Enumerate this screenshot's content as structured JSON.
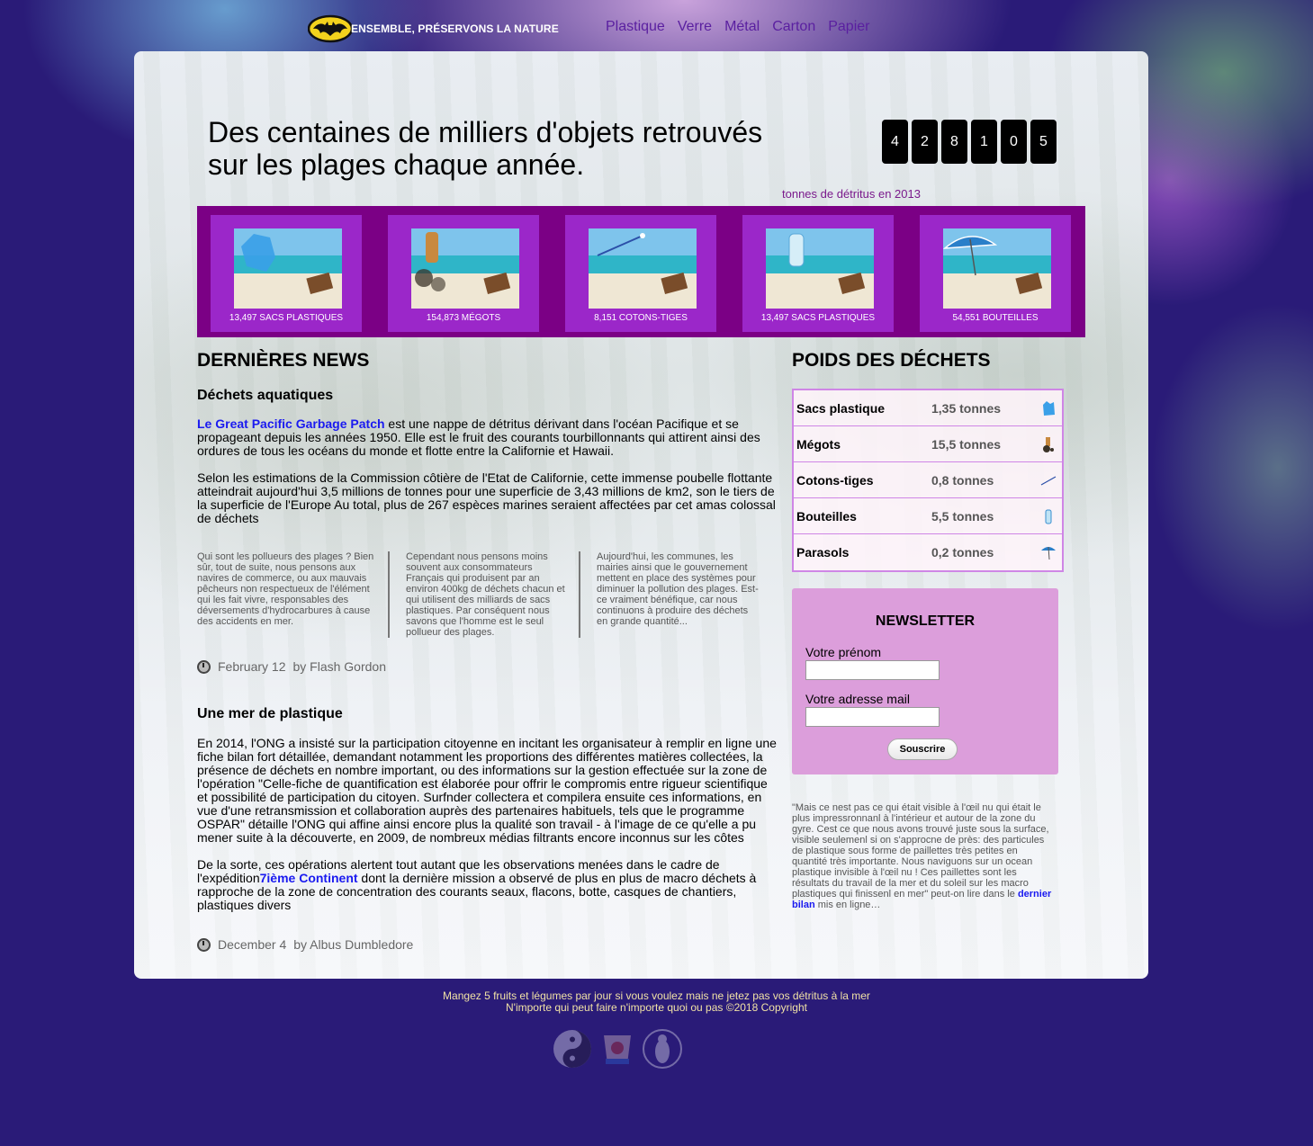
{
  "brand": "ENSEMBLE, PRÉSERVONS LA NATURE",
  "nav": [
    "Plastique",
    "Verre",
    "Métal",
    "Carton",
    "Papier"
  ],
  "headline": "Des centaines de milliers d'objets retrouvés sur les plages chaque année.",
  "counter": {
    "digits": [
      "4",
      "2",
      "8",
      "1",
      "0",
      "5"
    ],
    "caption": "tonnes de détritus en 2013"
  },
  "tiles": [
    {
      "caption": "13,497 SACS PLASTIQUES",
      "icon": "plastic-bag-icon"
    },
    {
      "caption": "154,873 MÉGOTS",
      "icon": "cigarette-butt-icon"
    },
    {
      "caption": "8,151 COTONS-TIGES",
      "icon": "cotton-swab-icon"
    },
    {
      "caption": "13,497 SACS PLASTIQUES",
      "icon": "water-bottle-icon"
    },
    {
      "caption": "54,551 BOUTEILLES",
      "icon": "parasol-icon"
    }
  ],
  "news": {
    "section_title": "DERNIÈRES NEWS",
    "articles": [
      {
        "title": "Déchets aquatiques",
        "link_text": "Le Great Pacific Garbage Patch",
        "p1_rest": " est une nappe de détritus dérivant dans l'océan Pacifique et se propageant depuis les années 1950. Elle est le fruit des courants tourbillonnants qui attirent ainsi des ordures de tous les océans du monde et flotte entre la Californie et Hawaii.",
        "p2": "Selon les estimations de la Commission côtière de l'Etat de Californie, cette immense poubelle flottante atteindrait aujourd'hui 3,5 millions de tonnes pour une superficie de 3,43 millions de km2, son le tiers de la superficie de l'Europe Au total, plus de 267 espèces marines seraient affectées par cet amas colossal de déchets",
        "columns": [
          "Qui sont les pollueurs des plages ? Bien sûr, tout de suite, nous pensons aux navires de commerce, ou aux mauvais pêcheurs non respectueux de l'élément qui les fait vivre, responsables des déversements d'hydrocarbures à cause des accidents en mer.",
          "Cependant nous pensons moins souvent aux consommateurs Français qui produisent par an environ 400kg de déchets chacun et qui utilisent des milliards de sacs plastiques. Par conséquent nous savons que l'homme est le seul pollueur des plages.",
          "Aujourd'hui, les communes, les mairies ainsi que le gouvernement mettent en place des systèmes pour diminuer la pollution des plages. Est-ce vraiment bénéfique, car nous continuons à produire des déchets en grande quantité..."
        ],
        "date": "February 12",
        "author": "by Flash Gordon"
      },
      {
        "title": "Une mer de plastique",
        "p1": "En 2014, l'ONG a insisté sur la participation citoyenne en incitant les organisateur à remplir en ligne une fiche bilan fort détaillée, demandant notamment les proportions des différentes matières collectées, la présence de déchets en nombre important, ou des informations sur la gestion effectuée sur la zone de l'opération \"Celle-fiche de quantification est élaborée pour offrir le compromis entre rigueur scientifique et possibilité de participation du citoyen. Surfnder collectera et compilera ensuite ces informations, en vue d'une retransmission et collaboration auprès des partenaires habituels, tels que le programme OSPAR\" détaille l'ONG qui affine ainsi encore plus la qualité son travail - à l'image de ce qu'elle a pu mener suite à la découverte, en 2009, de nombreux médias filtrants encore inconnus sur les côtes",
        "p2_before": "De la sorte, ces opérations alertent tout autant que les observations menées dans le cadre de l'expédition",
        "link_text": "7ième Continent",
        "p2_after": " dont la dernière mission a observé de plus en plus de macro déchets à rapproche de la zone de concentration des courants seaux, flacons, botte, casques de chantiers, plastiques divers",
        "date": "December 4",
        "author": "by Albus Dumbledore"
      }
    ]
  },
  "weights": {
    "title": "POIDS DES DÉCHETS",
    "rows": [
      {
        "name": "Sacs plastique",
        "value": "1,35 tonnes",
        "icon": "plastic-bag-icon"
      },
      {
        "name": "Mégots",
        "value": "15,5 tonnes",
        "icon": "cigarette-butt-icon"
      },
      {
        "name": "Cotons-tiges",
        "value": "0,8 tonnes",
        "icon": "cotton-swab-icon"
      },
      {
        "name": "Bouteilles",
        "value": "5,5 tonnes",
        "icon": "water-bottle-icon"
      },
      {
        "name": "Parasols",
        "value": "0,2 tonnes",
        "icon": "parasol-icon"
      }
    ]
  },
  "newsletter": {
    "title": "NEWSLETTER",
    "first_name_label": "Votre prénom",
    "email_label": "Votre adresse mail",
    "first_name_value": "",
    "email_value": "",
    "submit": "Souscrire"
  },
  "quote": {
    "text": "\"Mais ce nest pas ce qui était visible à l'œil nu qui était le plus impressronnanl à l'intérieur et autour de la zone du gyre. Cest ce que nous avons trouvé juste sous la surface, visible seulemenl si on s'approcne de près: des particules de plastique sous forme de paillettes très petites en quantité très importante. Nous naviguons sur un ocean plastique invisible à l'œil nu ! Ces paillettes sont les résultats du travail de la mer et du soleil sur les macro plastiques qui finissenl en mer\" peut-on lire dans le ",
    "link_text": "dernier bilan",
    "after": " mis en ligne…"
  },
  "footer": {
    "line1": "Mangez 5 fruits et légumes par jour si vous voulez mais ne jetez pas vos détritus à la mer",
    "line2": "N'importe qui peut faire n'importe quoi ou pas ©2018 Copyright",
    "icons": [
      "yin-yang-icon",
      "cup-icon",
      "penguin-icon"
    ]
  },
  "colors": {
    "accent_purple": "#7b0085",
    "tile_purple": "#9b27c9",
    "newsletter_bg": "#dc9edb",
    "link_blue": "#1a1af0",
    "nav_purple": "#5a1fa0"
  }
}
